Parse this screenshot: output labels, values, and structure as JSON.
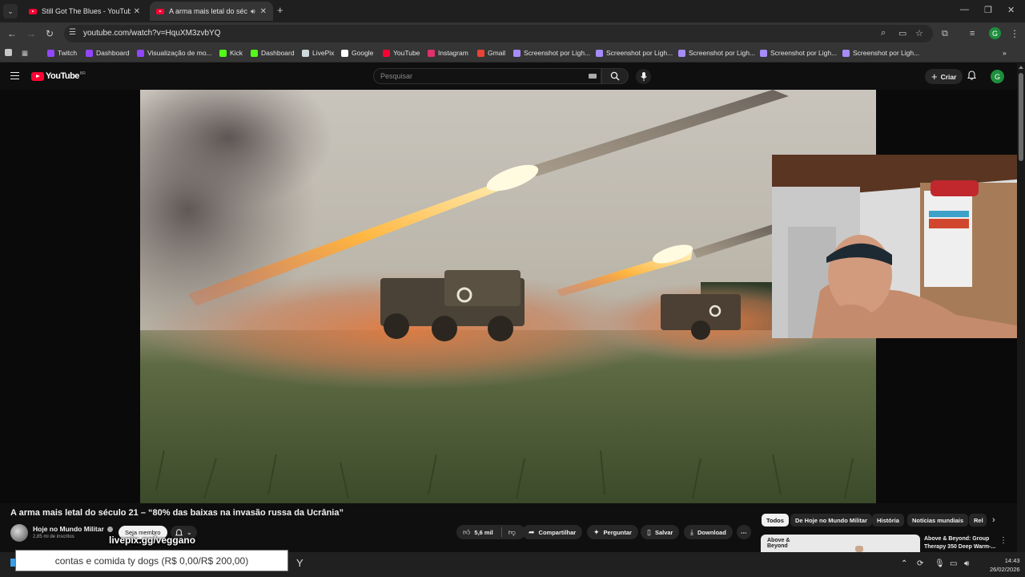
{
  "browser": {
    "tabs": [
      {
        "title": "Still Got The Blues - YouTube",
        "active": false
      },
      {
        "title": "A arma mais letal do sécul",
        "active": true
      }
    ],
    "url": "youtube.com/watch?v=HquXM3zvbYQ",
    "profile_initial": "G",
    "bookmarks": [
      {
        "label": "Twitch",
        "icon": "twitch-icon",
        "color": "#9146ff"
      },
      {
        "label": "Dashboard",
        "icon": "twitch-icon",
        "color": "#9146ff"
      },
      {
        "label": "Visualização de mo...",
        "icon": "twitch-icon",
        "color": "#9146ff"
      },
      {
        "label": "Kick",
        "icon": "kick-icon",
        "color": "#53fc18"
      },
      {
        "label": "Dashboard",
        "icon": "kick-icon",
        "color": "#53fc18"
      },
      {
        "label": "LivePix",
        "icon": "livepix-icon",
        "color": "#cfd8dc"
      },
      {
        "label": "Google",
        "icon": "google-icon",
        "color": "#ffffff"
      },
      {
        "label": "YouTube",
        "icon": "youtube-icon",
        "color": "#ff0033"
      },
      {
        "label": "Instagram",
        "icon": "instagram-icon",
        "color": "#e1306c"
      },
      {
        "label": "Gmail",
        "icon": "gmail-icon",
        "color": "#ea4335"
      },
      {
        "label": "Screenshot por Ligh...",
        "icon": "lightshot-icon",
        "color": "#a78bfa"
      },
      {
        "label": "Screenshot por Ligh...",
        "icon": "lightshot-icon",
        "color": "#a78bfa"
      },
      {
        "label": "Screenshot por Ligh...",
        "icon": "lightshot-icon",
        "color": "#a78bfa"
      },
      {
        "label": "Screenshot por Ligh...",
        "icon": "lightshot-icon",
        "color": "#a78bfa"
      },
      {
        "label": "Screenshot por Ligh...",
        "icon": "lightshot-icon",
        "color": "#a78bfa"
      }
    ],
    "bookmarks_more": "»"
  },
  "youtube": {
    "logo": "YouTube",
    "logo_country": "BR",
    "search_placeholder": "Pesquisar",
    "create_label": "Criar",
    "avatar_initial": "G",
    "video": {
      "title": "A arma mais letal do século 21 – “80% das baixas na invasão russa da Ucrânia”",
      "channel": "Hoje no Mundo Militar",
      "subscribers": "2,85 mi de inscritos",
      "member_label": "Seja membro",
      "likes": "5,6 mil",
      "share_label": "Compartilhar",
      "ask_label": "Perguntar",
      "save_label": "Salvar",
      "download_label": "Download",
      "more_label": "⋯"
    },
    "chips": [
      "Todos",
      "De Hoje no Mundo Militar",
      "História",
      "Notícias mundiais",
      "Rel"
    ],
    "recommendation": {
      "title": "Above & Beyond: Group Therapy 350 Deep Warm-...",
      "thumb_text": "Above & Beyond"
    }
  },
  "overlay": {
    "livepix_url": "livepix.gg/veggano",
    "donation_text": "contas e comida ty dogs (R$ 0,00/R$ 200,00)",
    "donation_current": 0,
    "donation_goal": 200
  },
  "taskbar": {
    "time": "14:43",
    "date": "26/02/2026"
  }
}
